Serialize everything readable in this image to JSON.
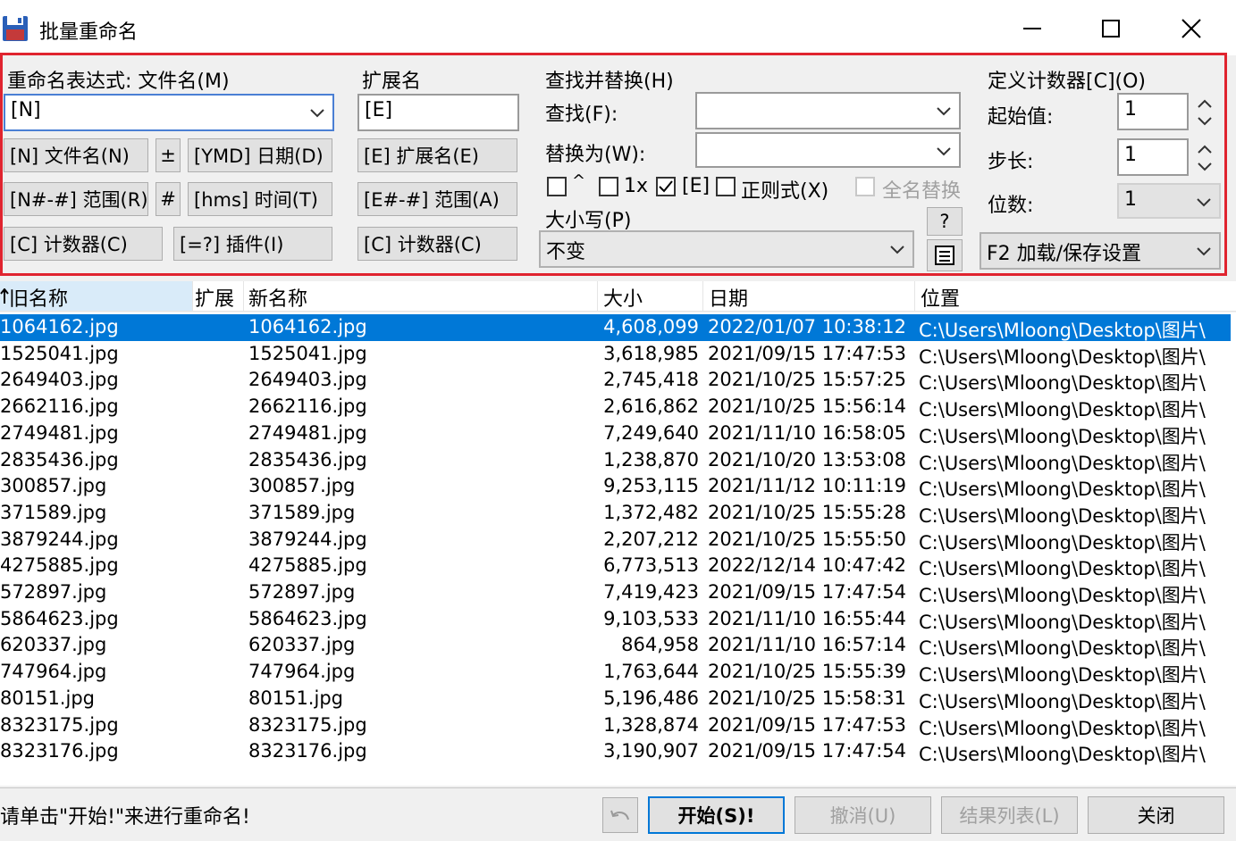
{
  "window": {
    "title": "批量重命名"
  },
  "rename_expr": {
    "label": "重命名表达式: 文件名(M)",
    "value": "[N]",
    "buttons": {
      "filename": "[N] 文件名(N)",
      "plusminus": "±",
      "date": "[YMD] 日期(D)",
      "range": "[N#-#] 范围(R)",
      "hash": "#",
      "time": "[hms] 时间(T)",
      "counter": "[C] 计数器(C)",
      "plugin": "[=?] 插件(I)"
    }
  },
  "extension": {
    "label": "扩展名",
    "value": "[E]",
    "buttons": {
      "ext": "[E] 扩展名(E)",
      "range": "[E#-#] 范围(A)",
      "counter": "[C] 计数器(C)"
    }
  },
  "find_replace": {
    "label": "查找并替换(H)",
    "find_label": "查找(F):",
    "find_value": "",
    "replace_label": "替换为(W):",
    "replace_value": "",
    "opt_caret": "^",
    "opt_1x": "1x",
    "opt_e": "[E]",
    "opt_regex": "正则式(X)",
    "opt_fullname": "全名替换",
    "case_label": "大小写(P)",
    "case_value": "不变",
    "help": "?"
  },
  "counter": {
    "label": "定义计数器[C](O)",
    "start_label": "起始值:",
    "start_value": "1",
    "step_label": "步长:",
    "step_value": "1",
    "digits_label": "位数:",
    "digits_value": "1",
    "settings": "F2 加载/保存设置"
  },
  "columns": {
    "old_name": "旧名称",
    "ext": "扩展",
    "new_name": "新名称",
    "size": "大小",
    "date": "日期",
    "location": "位置"
  },
  "rows": [
    {
      "old": "1064162.jpg",
      "new": "1064162.jpg",
      "size": "4,608,099",
      "date": "2022/01/07 10:38:12",
      "loc": "C:\\Users\\Mloong\\Desktop\\图片\\"
    },
    {
      "old": "1525041.jpg",
      "new": "1525041.jpg",
      "size": "3,618,985",
      "date": "2021/09/15 17:47:53",
      "loc": "C:\\Users\\Mloong\\Desktop\\图片\\"
    },
    {
      "old": "2649403.jpg",
      "new": "2649403.jpg",
      "size": "2,745,418",
      "date": "2021/10/25 15:57:25",
      "loc": "C:\\Users\\Mloong\\Desktop\\图片\\"
    },
    {
      "old": "2662116.jpg",
      "new": "2662116.jpg",
      "size": "2,616,862",
      "date": "2021/10/25 15:56:14",
      "loc": "C:\\Users\\Mloong\\Desktop\\图片\\"
    },
    {
      "old": "2749481.jpg",
      "new": "2749481.jpg",
      "size": "7,249,640",
      "date": "2021/11/10 16:58:05",
      "loc": "C:\\Users\\Mloong\\Desktop\\图片\\"
    },
    {
      "old": "2835436.jpg",
      "new": "2835436.jpg",
      "size": "1,238,870",
      "date": "2021/10/20 13:53:08",
      "loc": "C:\\Users\\Mloong\\Desktop\\图片\\"
    },
    {
      "old": "300857.jpg",
      "new": "300857.jpg",
      "size": "9,253,115",
      "date": "2021/11/12 10:11:19",
      "loc": "C:\\Users\\Mloong\\Desktop\\图片\\"
    },
    {
      "old": "371589.jpg",
      "new": "371589.jpg",
      "size": "1,372,482",
      "date": "2021/10/25 15:55:28",
      "loc": "C:\\Users\\Mloong\\Desktop\\图片\\"
    },
    {
      "old": "3879244.jpg",
      "new": "3879244.jpg",
      "size": "2,207,212",
      "date": "2021/10/25 15:55:50",
      "loc": "C:\\Users\\Mloong\\Desktop\\图片\\"
    },
    {
      "old": "4275885.jpg",
      "new": "4275885.jpg",
      "size": "6,773,513",
      "date": "2022/12/14 10:47:42",
      "loc": "C:\\Users\\Mloong\\Desktop\\图片\\"
    },
    {
      "old": "572897.jpg",
      "new": "572897.jpg",
      "size": "7,419,423",
      "date": "2021/09/15 17:47:54",
      "loc": "C:\\Users\\Mloong\\Desktop\\图片\\"
    },
    {
      "old": "5864623.jpg",
      "new": "5864623.jpg",
      "size": "9,103,533",
      "date": "2021/11/10 16:55:44",
      "loc": "C:\\Users\\Mloong\\Desktop\\图片\\"
    },
    {
      "old": "620337.jpg",
      "new": "620337.jpg",
      "size": "864,958",
      "date": "2021/11/10 16:57:14",
      "loc": "C:\\Users\\Mloong\\Desktop\\图片\\"
    },
    {
      "old": "747964.jpg",
      "new": "747964.jpg",
      "size": "1,763,644",
      "date": "2021/10/25 15:55:39",
      "loc": "C:\\Users\\Mloong\\Desktop\\图片\\"
    },
    {
      "old": "80151.jpg",
      "new": "80151.jpg",
      "size": "5,196,486",
      "date": "2021/10/25 15:58:31",
      "loc": "C:\\Users\\Mloong\\Desktop\\图片\\"
    },
    {
      "old": "8323175.jpg",
      "new": "8323175.jpg",
      "size": "1,328,874",
      "date": "2021/09/15 17:47:53",
      "loc": "C:\\Users\\Mloong\\Desktop\\图片\\"
    },
    {
      "old": "8323176.jpg",
      "new": "8323176.jpg",
      "size": "3,190,907",
      "date": "2021/09/15 17:47:54",
      "loc": "C:\\Users\\Mloong\\Desktop\\图片\\"
    }
  ],
  "status": {
    "message": "请单击\"开始!\"来进行重命名!",
    "start": "开始(S)!",
    "undo": "撤消(U)",
    "results": "结果列表(L)",
    "close": "关闭"
  },
  "colors": {
    "highlight": "#e0242f",
    "selection": "#0078d7"
  },
  "icons": [
    "floppy-disk-icon",
    "minimize-icon",
    "maximize-icon",
    "close-icon",
    "chevron-down-icon",
    "spin-up-down-icon",
    "notepad-icon",
    "undo-arrow-icon"
  ]
}
